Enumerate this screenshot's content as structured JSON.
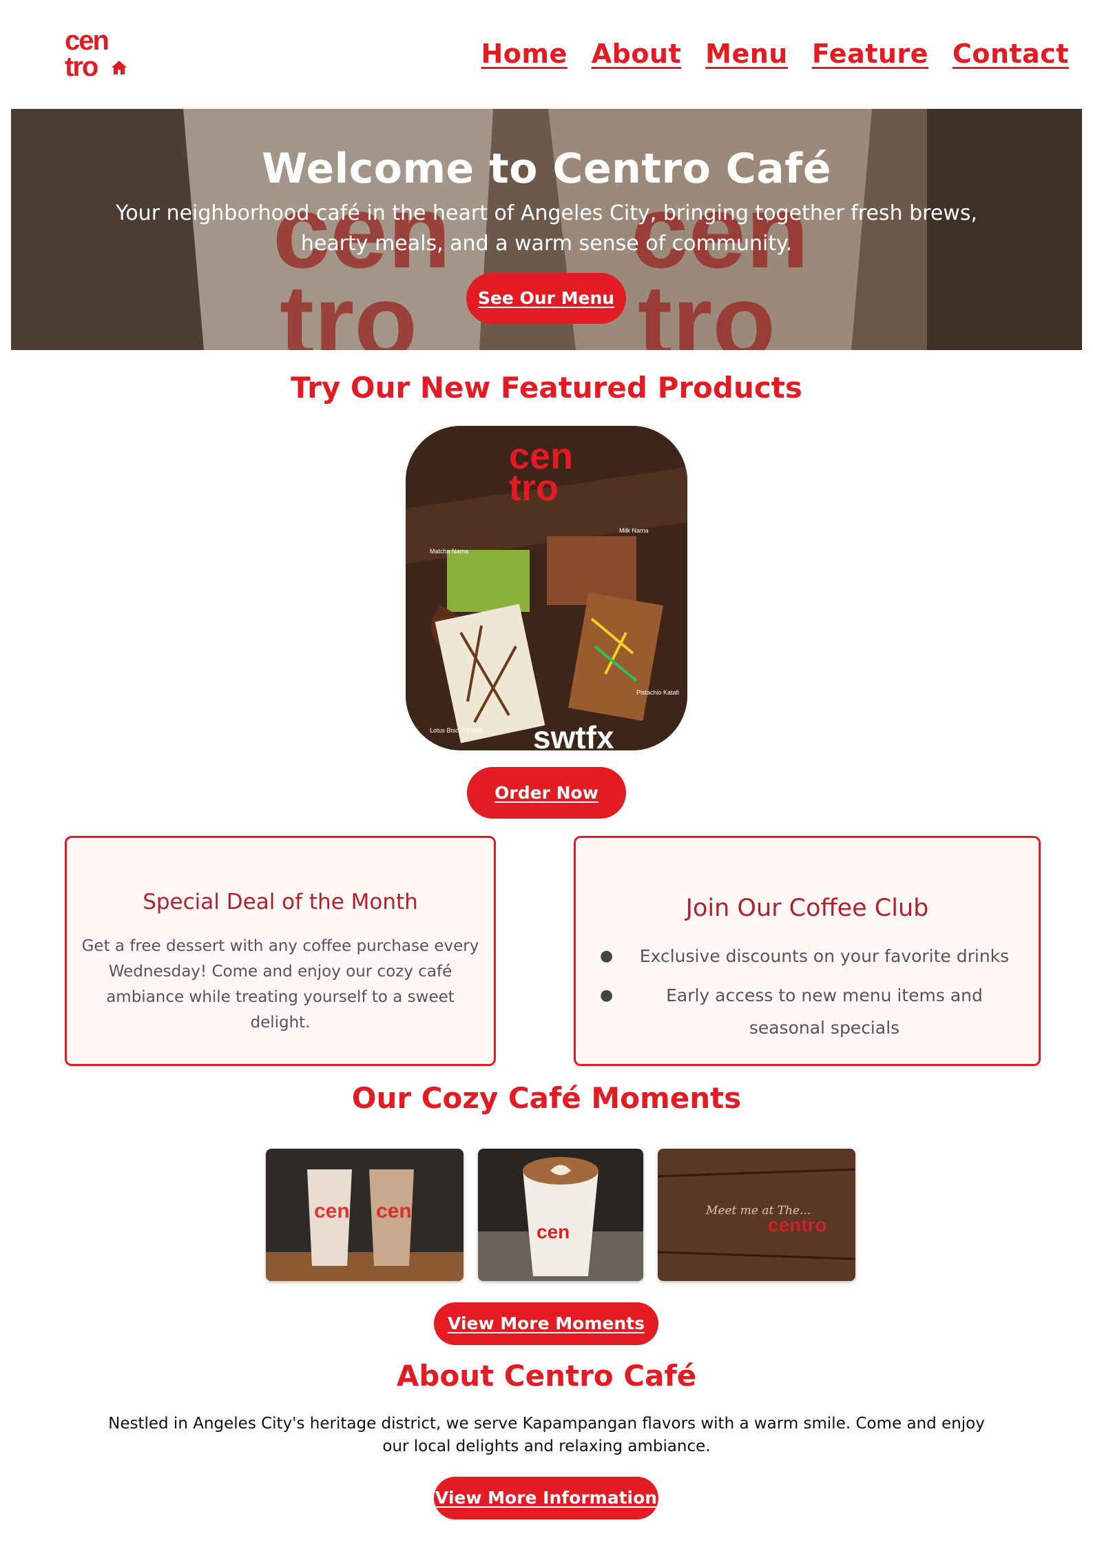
{
  "brand": {
    "logo_line1": "cen",
    "logo_line2": "tro",
    "accent": "#e31b23"
  },
  "nav": {
    "items": [
      "Home",
      "About",
      "Menu",
      "Feature",
      "Contact"
    ]
  },
  "hero": {
    "title": "Welcome to Centro Café",
    "subtitle": "Your neighborhood café in the heart of Angeles City, bringing together fresh brews, hearty meals, and a warm sense of community.",
    "button": "See Our Menu"
  },
  "featured": {
    "title": "Try Our New Featured Products",
    "image_logo_line1": "cen",
    "image_logo_line2": "tro",
    "image_labels": [
      "Matcha Nama",
      "Milk Nama",
      "Pistachio Katafi",
      "Lotus Biscoff Katafi"
    ],
    "image_brand": "swtfx",
    "button": "Order Now"
  },
  "deal": {
    "title": "Special Deal of the Month",
    "text": "Get a free dessert with any coffee purchase every Wednesday! Come and enjoy our cozy café ambiance while treating yourself to a sweet delight."
  },
  "club": {
    "title": "Join Our Coffee Club",
    "items": [
      "Exclusive discounts on your favorite drinks",
      "Early access to new menu items and seasonal specials"
    ]
  },
  "moments": {
    "title": "Our Cozy Café Moments",
    "photo3_script": "Meet me at The...",
    "photo3_brand": "centro",
    "button": "View More Moments"
  },
  "about": {
    "title": "About Centro Café",
    "text": "Nestled in Angeles City's heritage district, we serve Kapampangan flavors with a warm smile. Come and enjoy our local delights and relaxing ambiance.",
    "button": "View More Information"
  }
}
